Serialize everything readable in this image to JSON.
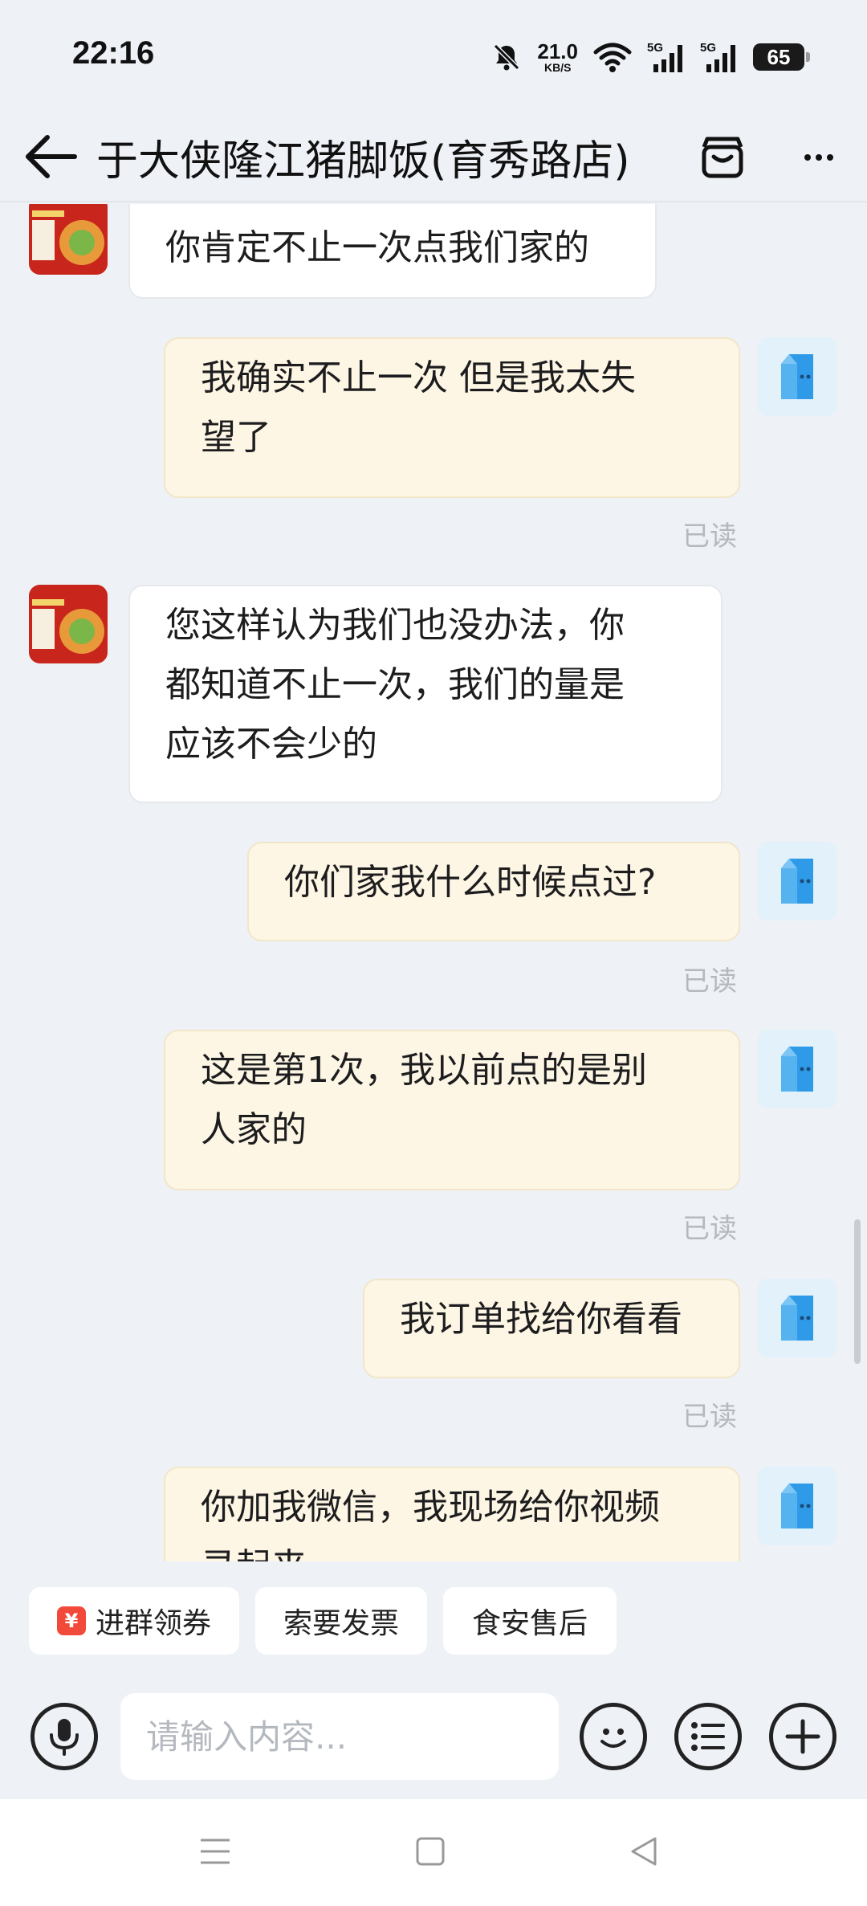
{
  "status_bar": {
    "time": "22:16",
    "net_speed": "21.0",
    "net_speed_unit": "KB/S",
    "signal1": "5G",
    "signal2": "5G",
    "battery": "65"
  },
  "header": {
    "title": "于大侠隆江猪脚饭(育秀路店)"
  },
  "messages": [
    {
      "side": "in",
      "text": "你肯定不止一次点我们家的"
    },
    {
      "side": "out",
      "line1": "我确实不止一次  但是我太失",
      "line2": "望了",
      "status": "已读"
    },
    {
      "side": "in",
      "line1": "您这样认为我们也没办法，你",
      "line2": "都知道不止一次，我们的量是",
      "line3": "应该不会少的"
    },
    {
      "side": "out",
      "text": "你们家我什么时候点过?",
      "status": "已读"
    },
    {
      "side": "out",
      "line1": "这是第1次，我以前点的是别",
      "line2": "人家的",
      "status": "已读"
    },
    {
      "side": "out",
      "text": "我订单找给你看看",
      "status": "已读"
    },
    {
      "side": "out",
      "line1": "你加我微信，我现场给你视频",
      "line2": "录起来"
    }
  ],
  "quick_actions": {
    "coupon_icon": "¥",
    "group_coupon": "进群领券",
    "request_invoice": "索要发票",
    "food_safety": "食安售后"
  },
  "input": {
    "placeholder": "请输入内容..."
  },
  "colors": {
    "background": "#eef1f6",
    "bubble_in": "#ffffff",
    "bubble_out": "#fdf6e4",
    "read_text": "#b5b8be",
    "coupon_red": "#f24a3a"
  }
}
